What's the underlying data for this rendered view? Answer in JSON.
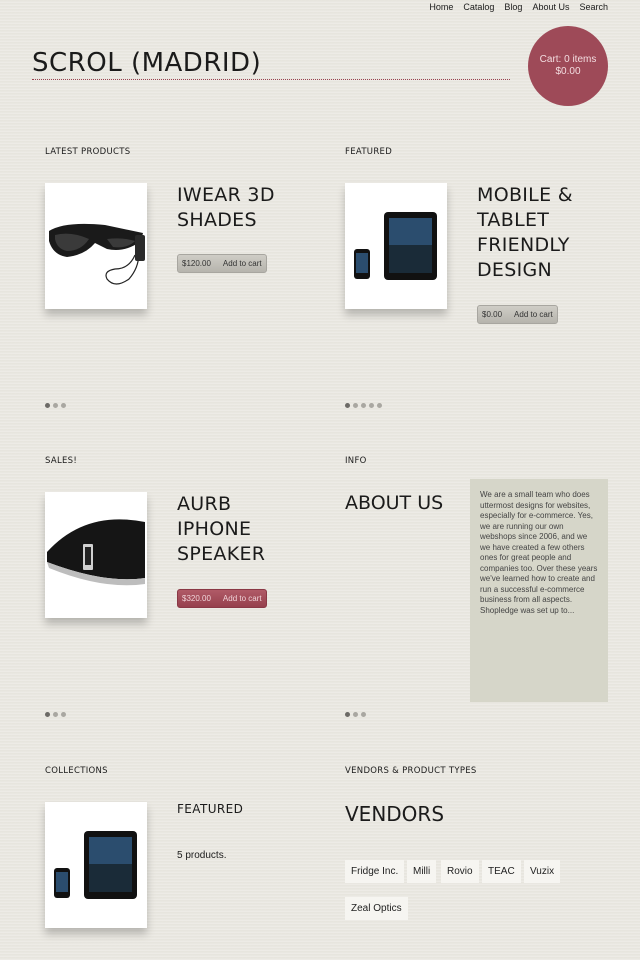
{
  "nav": [
    "Home",
    "Catalog",
    "Blog",
    "About Us",
    "Search"
  ],
  "site_title": "SCROL (MADRID)",
  "cart": {
    "line1": "Cart: 0 items",
    "line2": "$0.00"
  },
  "latest": {
    "label": "LATEST PRODUCTS",
    "title_lines": [
      "IWEAR 3D",
      "SHADES"
    ],
    "price": "$120.00",
    "add": "Add to cart",
    "dots": 3
  },
  "featured": {
    "label": "FEATURED",
    "title_lines": [
      "MOBILE &",
      "TABLET",
      "FRIENDLY",
      "DESIGN"
    ],
    "price": "$0.00",
    "add": "Add to cart",
    "dots": 5
  },
  "sales": {
    "label": "SALES!",
    "title_lines": [
      "AURB",
      "IPHONE",
      "SPEAKER"
    ],
    "price": "$320.00",
    "add": "Add to cart",
    "dots": 3
  },
  "info": {
    "label": "INFO",
    "title": "ABOUT US",
    "text": "We are a small team who does uttermost designs for websites, especially for e-commerce. Yes, we are running our own webshops since 2006, and we we have created a few others ones for great people and companies too. Over these years we've learned how to create and run a successful e-commerce business from all aspects.  Shopledge was set up to...",
    "dots": 3
  },
  "collections": {
    "label": "COLLECTIONS",
    "title": "FEATURED",
    "count": "5 products."
  },
  "vendors": {
    "label": "VENDORS & PRODUCT TYPES",
    "title": "VENDORS",
    "items": [
      "Fridge Inc.",
      "Milli",
      "Rovio",
      "TEAC",
      "Vuzix",
      "Zeal Optics"
    ]
  },
  "colors": {
    "accent": "#9e4a58",
    "background": "#e9e7e0",
    "info_box": "#d6d6c9"
  }
}
